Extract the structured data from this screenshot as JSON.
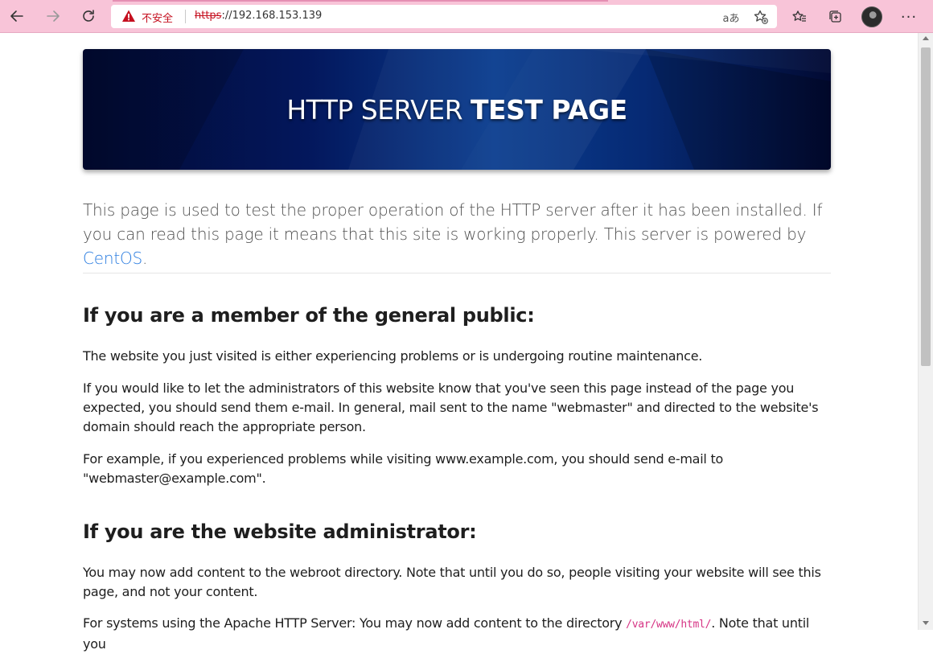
{
  "browser": {
    "security_label": "不安全",
    "url_scheme": "https",
    "url_rest": "://192.168.153.139",
    "read_aloud_icon": "aあ"
  },
  "banner": {
    "title_light": "HTTP SERVER",
    "title_bold": "TEST PAGE"
  },
  "intro": {
    "text": "This page is used to test the proper operation of the HTTP server after it has been installed. If you can read this page it means that this site is working properly. This server is powered by ",
    "link": "CentOS",
    "end": "."
  },
  "public_section": {
    "heading": "If you are a member of the general public:",
    "p1": "The website you just visited is either experiencing problems or is undergoing routine maintenance.",
    "p2": "If you would like to let the administrators of this website know that you've seen this page instead of the page you expected, you should send them e-mail. In general, mail sent to the name \"webmaster\" and directed to the website's domain should reach the appropriate person.",
    "p3": "For example, if you experienced problems while visiting www.example.com, you should send e-mail to \"webmaster@example.com\"."
  },
  "admin_section": {
    "heading": "If you are the website administrator:",
    "p1": "You may now add content to the webroot directory. Note that until you do so, people visiting your website will see this page, and not your content.",
    "p2_start": "For systems using the Apache HTTP Server: You may now add content to the directory ",
    "p2_code": "/var/www/html/",
    "p2_end": ". Note that until you"
  },
  "colors": {
    "toolbar": "#f8c4d8",
    "link": "#2b7de0",
    "insecure": "#c50f1f",
    "banner_dark": "#020a33",
    "banner_light": "#0a3d8f"
  }
}
